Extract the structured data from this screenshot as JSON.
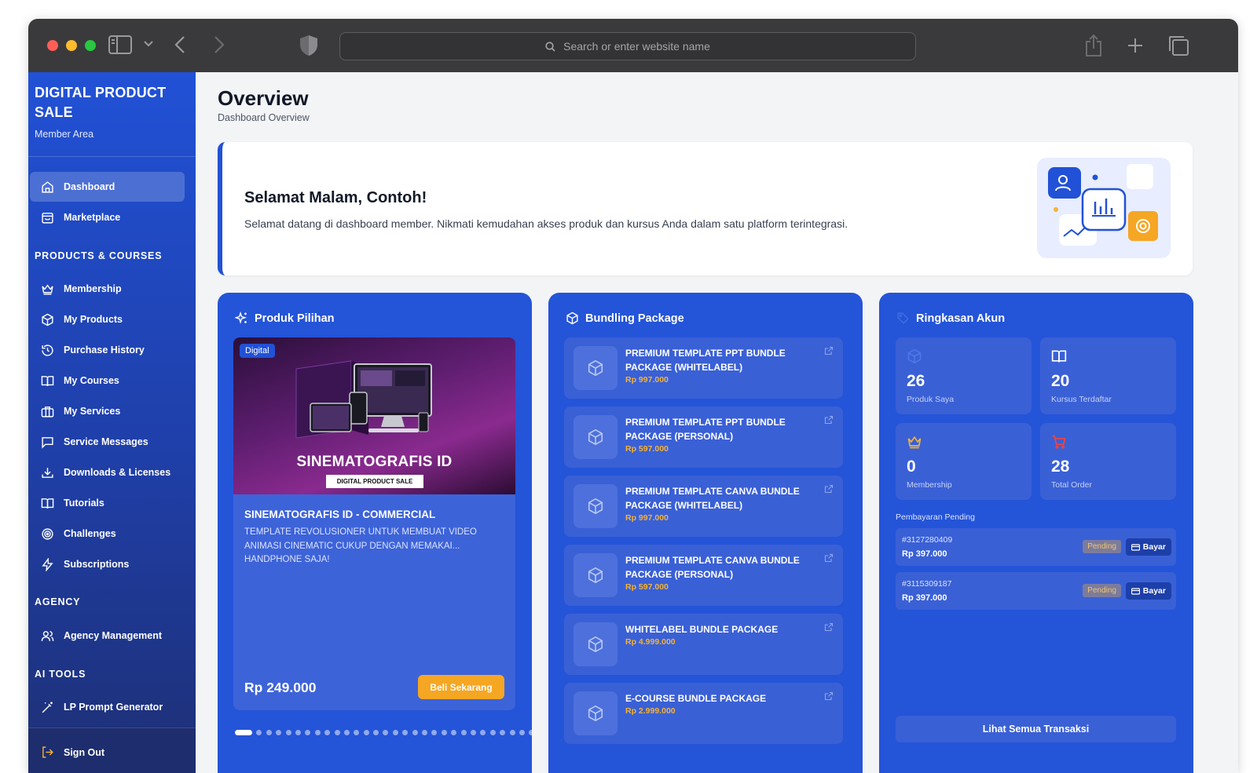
{
  "browser": {
    "url_placeholder": "Search or enter website name"
  },
  "sidebar": {
    "brand_title": "DIGITAL PRODUCT SALE",
    "brand_sub": "Member Area",
    "main_items": [
      {
        "label": "Dashboard",
        "icon": "home-icon"
      },
      {
        "label": "Marketplace",
        "icon": "store-icon"
      }
    ],
    "sections": {
      "products": "PRODUCTS & COURSES",
      "agency": "AGENCY",
      "ai": "AI TOOLS"
    },
    "product_items": [
      {
        "label": "Membership",
        "icon": "crown-icon"
      },
      {
        "label": "My Products",
        "icon": "box-icon"
      },
      {
        "label": "Purchase History",
        "icon": "history-icon"
      },
      {
        "label": "My Courses",
        "icon": "book-icon"
      },
      {
        "label": "My Services",
        "icon": "briefcase-icon"
      },
      {
        "label": "Service Messages",
        "icon": "message-icon"
      },
      {
        "label": "Downloads & Licenses",
        "icon": "download-icon"
      },
      {
        "label": "Tutorials",
        "icon": "book-open-icon"
      },
      {
        "label": "Challenges",
        "icon": "target-icon"
      },
      {
        "label": "Subscriptions",
        "icon": "bolt-icon"
      }
    ],
    "agency_items": [
      {
        "label": "Agency Management",
        "icon": "users-icon"
      }
    ],
    "ai_items": [
      {
        "label": "LP Prompt Generator",
        "icon": "magic-wand-icon"
      }
    ],
    "sign_out": "Sign Out"
  },
  "header": {
    "title": "Overview",
    "subtitle": "Dashboard Overview"
  },
  "welcome": {
    "title": "Selamat Malam, Contoh!",
    "text": "Selamat datang di dashboard member. Nikmati kemudahan akses produk dan kursus Anda dalam satu platform terintegrasi."
  },
  "featured": {
    "title": "Produk Pilihan",
    "badge": "Digital",
    "image_title": "SINEMATOGRAFIS ID",
    "image_sub": "DIGITAL PRODUCT SALE",
    "name": "SINEMATOGRAFIS ID - COMMERCIAL",
    "description": "TEMPLATE REVOLUSIONER UNTUK MEMBUAT VIDEO ANIMASI CINEMATIC CUKUP DENGAN MEMAKAI... HANDPHONE SAJA!",
    "price": "Rp 249.000",
    "buy_label": "Beli Sekarang",
    "slide_count": 30,
    "active_slide": 1
  },
  "bundles": {
    "title": "Bundling Package",
    "items": [
      {
        "name": "PREMIUM TEMPLATE PPT BUNDLE PACKAGE (WHITELABEL)",
        "price": "Rp 997.000"
      },
      {
        "name": "PREMIUM TEMPLATE PPT BUNDLE PACKAGE (PERSONAL)",
        "price": "Rp 597.000"
      },
      {
        "name": "PREMIUM TEMPLATE CANVA BUNDLE PACKAGE (WHITELABEL)",
        "price": "Rp 997.000"
      },
      {
        "name": "PREMIUM TEMPLATE CANVA BUNDLE PACKAGE (PERSONAL)",
        "price": "Rp 597.000"
      },
      {
        "name": "WHITELABEL BUNDLE PACKAGE",
        "price": "Rp 4.999.000"
      },
      {
        "name": "E-COURSE BUNDLE PACKAGE",
        "price": "Rp 2.999.000"
      }
    ]
  },
  "summary": {
    "title": "Ringkasan Akun",
    "stats": [
      {
        "value": "26",
        "label": "Produk Saya",
        "icon": "box-icon",
        "color": "#3f6ee0"
      },
      {
        "value": "20",
        "label": "Kursus Terdaftar",
        "icon": "book-icon",
        "color": "#ffffff"
      },
      {
        "value": "0",
        "label": "Membership",
        "icon": "crown-icon",
        "color": "#f5b335"
      },
      {
        "value": "28",
        "label": "Total Order",
        "icon": "cart-icon",
        "color": "#ef4444"
      }
    ],
    "pending_label": "Pembayaran Pending",
    "pending": [
      {
        "id": "#3127280409",
        "amount": "Rp 397.000",
        "status": "Pending",
        "pay": "Bayar"
      },
      {
        "id": "#3115309187",
        "amount": "Rp 397.000",
        "status": "Pending",
        "pay": "Bayar"
      }
    ],
    "all_label": "Lihat Semua Transaksi"
  },
  "colors": {
    "primary": "#2151d6",
    "card": "#2454d8",
    "accent": "#f5a623"
  }
}
